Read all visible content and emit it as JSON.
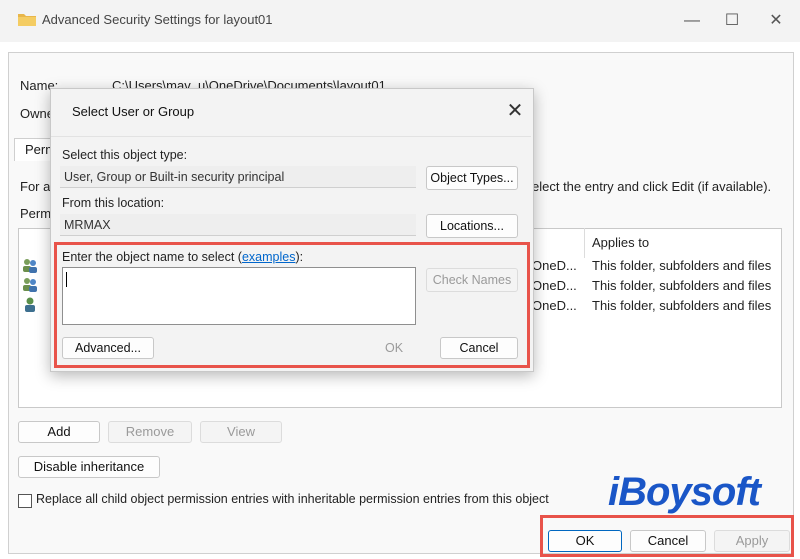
{
  "window": {
    "title": "Advanced Security Settings for layout01",
    "minimize": "—",
    "maximize": "☐",
    "close": "✕"
  },
  "outer": {
    "name_label": "Name:",
    "name_value": "C:\\Users\\mav_u\\OneDrive\\Documents\\layout01",
    "owner_label": "Owne",
    "tab_label": "Perm",
    "for_text": "For a",
    "instructions_tail": "elect the entry and click Edit (if available).",
    "perm_entries_label": "Perm",
    "applies_to_header": "Applies to",
    "rows": [
      {
        "path": "OneD...",
        "applies": "This folder, subfolders and files"
      },
      {
        "path": "OneD...",
        "applies": "This folder, subfolders and files"
      },
      {
        "path": "OneD...",
        "applies": "This folder, subfolders and files"
      }
    ],
    "add_label": "Add",
    "remove_label": "Remove",
    "view_label": "View",
    "disable_inheritance_label": "Disable inheritance",
    "replace_label": "Replace all child object permission entries with inheritable permission entries from this object",
    "ok_label": "OK",
    "cancel_label": "Cancel",
    "apply_label": "Apply"
  },
  "dialog": {
    "title": "Select User or Group",
    "close": "✕",
    "object_type_label": "Select this object type:",
    "object_type_value": "User, Group or Built-in security principal",
    "object_types_button": "Object Types...",
    "location_label": "From this location:",
    "location_value": "MRMAX",
    "locations_button": "Locations...",
    "enter_label_prefix": "Enter the object name to select (",
    "examples_link": "examples",
    "enter_label_suffix": "):",
    "check_names_button": "Check Names",
    "advanced_button": "Advanced...",
    "ok_button": "OK",
    "cancel_button": "Cancel"
  },
  "watermark": {
    "text": "iBoysoft"
  },
  "icons": {
    "folder": "folder-icon",
    "user": "user-group-icon"
  },
  "colors": {
    "highlight": "#e8534a",
    "link": "#0066cc",
    "watermark": "#1a56c7"
  }
}
